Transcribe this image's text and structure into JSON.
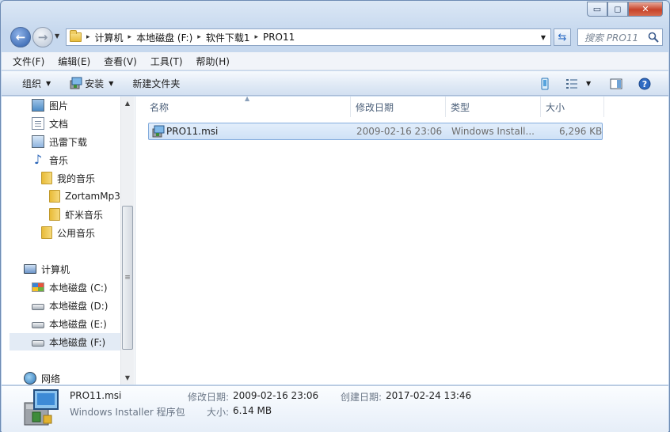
{
  "window": {
    "caption": {
      "minimize": "▭",
      "maximize": "◻",
      "close": "✕"
    }
  },
  "address": {
    "crumbs": [
      "计算机",
      "本地磁盘 (F:)",
      "软件下载1",
      "PRO11"
    ],
    "separator": "▸",
    "search_placeholder": "搜索 PRO11"
  },
  "menu": [
    "文件(F)",
    "编辑(E)",
    "查看(V)",
    "工具(T)",
    "帮助(H)"
  ],
  "toolbar": {
    "organize": "组织",
    "install": "安装",
    "new_folder": "新建文件夹"
  },
  "nav_tree": [
    {
      "label": "图片",
      "icon": "pictures-icon"
    },
    {
      "label": "文档",
      "icon": "documents-icon"
    },
    {
      "label": "迅雷下载",
      "icon": "downloads-icon"
    },
    {
      "label": "音乐",
      "icon": "music-icon"
    },
    {
      "label": "我的音乐",
      "icon": "folder-icon"
    },
    {
      "label": "ZortamMp3",
      "icon": "folder-icon"
    },
    {
      "label": "虾米音乐",
      "icon": "folder-icon"
    },
    {
      "label": "公用音乐",
      "icon": "folder-icon"
    },
    {
      "label": "计算机",
      "icon": "computer-icon"
    },
    {
      "label": "本地磁盘 (C:)",
      "icon": "windows-drive-icon"
    },
    {
      "label": "本地磁盘 (D:)",
      "icon": "drive-icon"
    },
    {
      "label": "本地磁盘 (E:)",
      "icon": "drive-icon"
    },
    {
      "label": "本地磁盘 (F:)",
      "icon": "drive-icon",
      "selected": true
    },
    {
      "label": "网络",
      "icon": "network-icon"
    }
  ],
  "columns": {
    "name": "名称",
    "modified": "修改日期",
    "type": "类型",
    "size": "大小"
  },
  "files": [
    {
      "name": "PRO11.msi",
      "modified": "2009-02-16 23:06",
      "type": "Windows Install...",
      "size": "6,296 KB"
    }
  ],
  "details": {
    "name": "PRO11.msi",
    "type": "Windows Installer 程序包",
    "modified_label": "修改日期:",
    "modified_value": "2009-02-16 23:06",
    "created_label": "创建日期:",
    "created_value": "2017-02-24 13:46",
    "size_label": "大小:",
    "size_value": "6.14 MB"
  }
}
